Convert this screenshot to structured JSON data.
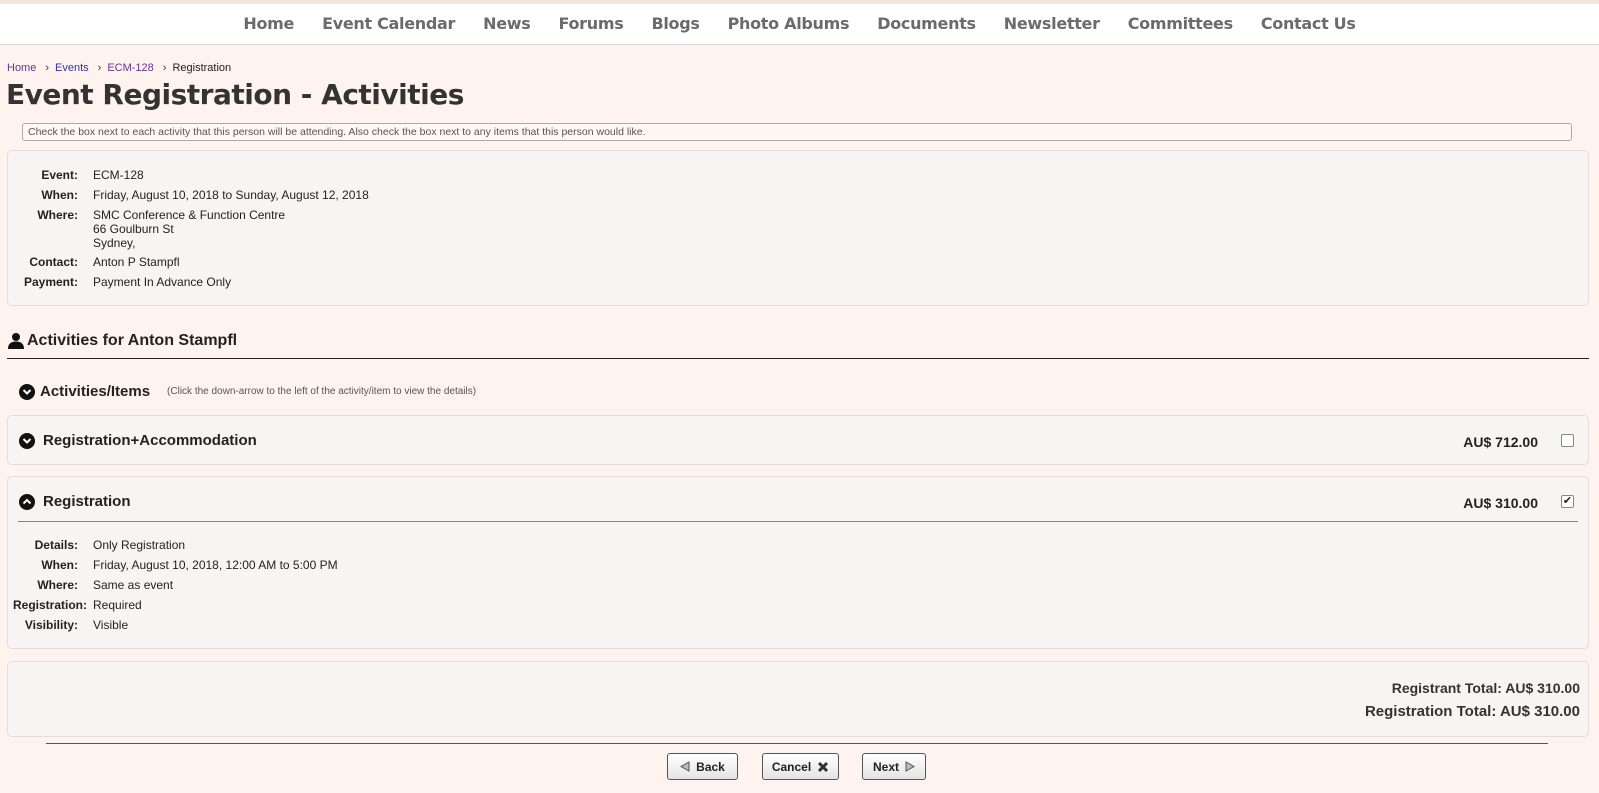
{
  "nav": [
    "Home",
    "Event Calendar",
    "News",
    "Forums",
    "Blogs",
    "Photo Albums",
    "Documents",
    "Newsletter",
    "Committees",
    "Contact Us"
  ],
  "breadcrumb": [
    "Home",
    "Events",
    "ECM-128",
    "Registration"
  ],
  "page_title": "Event Registration - Activities",
  "instructions": "Check the box next to each activity that this person will be attending. Also check the box next to any items that this person would like.",
  "event_info": {
    "event_label": "Event:",
    "event": "ECM-128",
    "when_label": "When:",
    "when": "Friday, August 10, 2018 to Sunday, August 12, 2018",
    "where_label": "Where:",
    "where_line1": "SMC Conference & Function Centre",
    "where_line2": "66 Goulburn St",
    "where_line3": "Sydney,",
    "contact_label": "Contact:",
    "contact": "Anton P Stampfl",
    "payment_label": "Payment:",
    "payment": "Payment In Advance Only"
  },
  "activities_for": "Activities for Anton Stampfl",
  "items_header": {
    "title": "Activities/Items",
    "hint": "(Click the down-arrow to the left of the activity/item to view the details)"
  },
  "activities": [
    {
      "title": "Registration+Accommodation",
      "price": "AU$ 712.00",
      "checked": false,
      "expanded": false
    },
    {
      "title": "Registration",
      "price": "AU$ 310.00",
      "checked": true,
      "expanded": true,
      "details_label": "Details:",
      "details": "Only Registration",
      "when_label": "When:",
      "when": "Friday, August 10, 2018, 12:00 AM to 5:00 PM",
      "where_label": "Where:",
      "where": "Same as event",
      "registration_label": "Registration:",
      "registration": "Required",
      "visibility_label": "Visibility:",
      "visibility": "Visible"
    }
  ],
  "totals": {
    "registrant": "Registrant Total: AU$ 310.00",
    "registration": "Registration Total: AU$ 310.00"
  },
  "buttons": {
    "back": "Back",
    "cancel": "Cancel",
    "next": "Next"
  },
  "colors": {
    "background": "#fff3ef",
    "panel": "#f7f5f4",
    "link": "#3333aa",
    "nav_text": "#6b6b6b"
  }
}
